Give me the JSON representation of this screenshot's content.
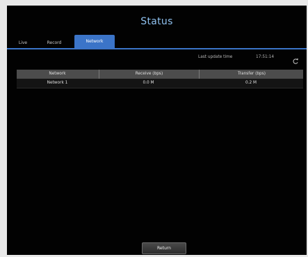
{
  "window": {
    "title": "Status"
  },
  "tabs": [
    {
      "label": "Live",
      "active": false
    },
    {
      "label": "Record",
      "active": false
    },
    {
      "label": "Network",
      "active": true
    }
  ],
  "last_update": {
    "label": "Last update time",
    "time": "17:51:14",
    "refresh_icon": "refresh-icon"
  },
  "table": {
    "headers": [
      "Network",
      "Receive (bps)",
      "Transfer (bps)"
    ],
    "rows": [
      [
        "Network 1",
        "0.0 M",
        "0.2 M"
      ]
    ]
  },
  "footer": {
    "return_label": "Return"
  },
  "colors": {
    "accent": "#3b74c8",
    "title": "#8fc1ef",
    "background": "#020202",
    "header_bg": "#4c4c4c"
  }
}
